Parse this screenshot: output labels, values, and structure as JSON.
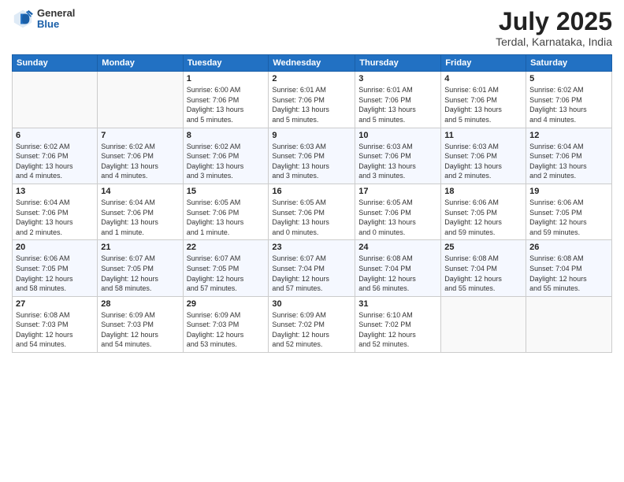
{
  "header": {
    "logo": {
      "general": "General",
      "blue": "Blue"
    },
    "title": "July 2025",
    "location": "Terdal, Karnataka, India"
  },
  "calendar": {
    "days_of_week": [
      "Sunday",
      "Monday",
      "Tuesday",
      "Wednesday",
      "Thursday",
      "Friday",
      "Saturday"
    ],
    "weeks": [
      [
        {
          "day": "",
          "info": ""
        },
        {
          "day": "",
          "info": ""
        },
        {
          "day": "1",
          "info": "Sunrise: 6:00 AM\nSunset: 7:06 PM\nDaylight: 13 hours\nand 5 minutes."
        },
        {
          "day": "2",
          "info": "Sunrise: 6:01 AM\nSunset: 7:06 PM\nDaylight: 13 hours\nand 5 minutes."
        },
        {
          "day": "3",
          "info": "Sunrise: 6:01 AM\nSunset: 7:06 PM\nDaylight: 13 hours\nand 5 minutes."
        },
        {
          "day": "4",
          "info": "Sunrise: 6:01 AM\nSunset: 7:06 PM\nDaylight: 13 hours\nand 5 minutes."
        },
        {
          "day": "5",
          "info": "Sunrise: 6:02 AM\nSunset: 7:06 PM\nDaylight: 13 hours\nand 4 minutes."
        }
      ],
      [
        {
          "day": "6",
          "info": "Sunrise: 6:02 AM\nSunset: 7:06 PM\nDaylight: 13 hours\nand 4 minutes."
        },
        {
          "day": "7",
          "info": "Sunrise: 6:02 AM\nSunset: 7:06 PM\nDaylight: 13 hours\nand 4 minutes."
        },
        {
          "day": "8",
          "info": "Sunrise: 6:02 AM\nSunset: 7:06 PM\nDaylight: 13 hours\nand 3 minutes."
        },
        {
          "day": "9",
          "info": "Sunrise: 6:03 AM\nSunset: 7:06 PM\nDaylight: 13 hours\nand 3 minutes."
        },
        {
          "day": "10",
          "info": "Sunrise: 6:03 AM\nSunset: 7:06 PM\nDaylight: 13 hours\nand 3 minutes."
        },
        {
          "day": "11",
          "info": "Sunrise: 6:03 AM\nSunset: 7:06 PM\nDaylight: 13 hours\nand 2 minutes."
        },
        {
          "day": "12",
          "info": "Sunrise: 6:04 AM\nSunset: 7:06 PM\nDaylight: 13 hours\nand 2 minutes."
        }
      ],
      [
        {
          "day": "13",
          "info": "Sunrise: 6:04 AM\nSunset: 7:06 PM\nDaylight: 13 hours\nand 2 minutes."
        },
        {
          "day": "14",
          "info": "Sunrise: 6:04 AM\nSunset: 7:06 PM\nDaylight: 13 hours\nand 1 minute."
        },
        {
          "day": "15",
          "info": "Sunrise: 6:05 AM\nSunset: 7:06 PM\nDaylight: 13 hours\nand 1 minute."
        },
        {
          "day": "16",
          "info": "Sunrise: 6:05 AM\nSunset: 7:06 PM\nDaylight: 13 hours\nand 0 minutes."
        },
        {
          "day": "17",
          "info": "Sunrise: 6:05 AM\nSunset: 7:06 PM\nDaylight: 13 hours\nand 0 minutes."
        },
        {
          "day": "18",
          "info": "Sunrise: 6:06 AM\nSunset: 7:05 PM\nDaylight: 12 hours\nand 59 minutes."
        },
        {
          "day": "19",
          "info": "Sunrise: 6:06 AM\nSunset: 7:05 PM\nDaylight: 12 hours\nand 59 minutes."
        }
      ],
      [
        {
          "day": "20",
          "info": "Sunrise: 6:06 AM\nSunset: 7:05 PM\nDaylight: 12 hours\nand 58 minutes."
        },
        {
          "day": "21",
          "info": "Sunrise: 6:07 AM\nSunset: 7:05 PM\nDaylight: 12 hours\nand 58 minutes."
        },
        {
          "day": "22",
          "info": "Sunrise: 6:07 AM\nSunset: 7:05 PM\nDaylight: 12 hours\nand 57 minutes."
        },
        {
          "day": "23",
          "info": "Sunrise: 6:07 AM\nSunset: 7:04 PM\nDaylight: 12 hours\nand 57 minutes."
        },
        {
          "day": "24",
          "info": "Sunrise: 6:08 AM\nSunset: 7:04 PM\nDaylight: 12 hours\nand 56 minutes."
        },
        {
          "day": "25",
          "info": "Sunrise: 6:08 AM\nSunset: 7:04 PM\nDaylight: 12 hours\nand 55 minutes."
        },
        {
          "day": "26",
          "info": "Sunrise: 6:08 AM\nSunset: 7:04 PM\nDaylight: 12 hours\nand 55 minutes."
        }
      ],
      [
        {
          "day": "27",
          "info": "Sunrise: 6:08 AM\nSunset: 7:03 PM\nDaylight: 12 hours\nand 54 minutes."
        },
        {
          "day": "28",
          "info": "Sunrise: 6:09 AM\nSunset: 7:03 PM\nDaylight: 12 hours\nand 54 minutes."
        },
        {
          "day": "29",
          "info": "Sunrise: 6:09 AM\nSunset: 7:03 PM\nDaylight: 12 hours\nand 53 minutes."
        },
        {
          "day": "30",
          "info": "Sunrise: 6:09 AM\nSunset: 7:02 PM\nDaylight: 12 hours\nand 52 minutes."
        },
        {
          "day": "31",
          "info": "Sunrise: 6:10 AM\nSunset: 7:02 PM\nDaylight: 12 hours\nand 52 minutes."
        },
        {
          "day": "",
          "info": ""
        },
        {
          "day": "",
          "info": ""
        }
      ]
    ]
  }
}
